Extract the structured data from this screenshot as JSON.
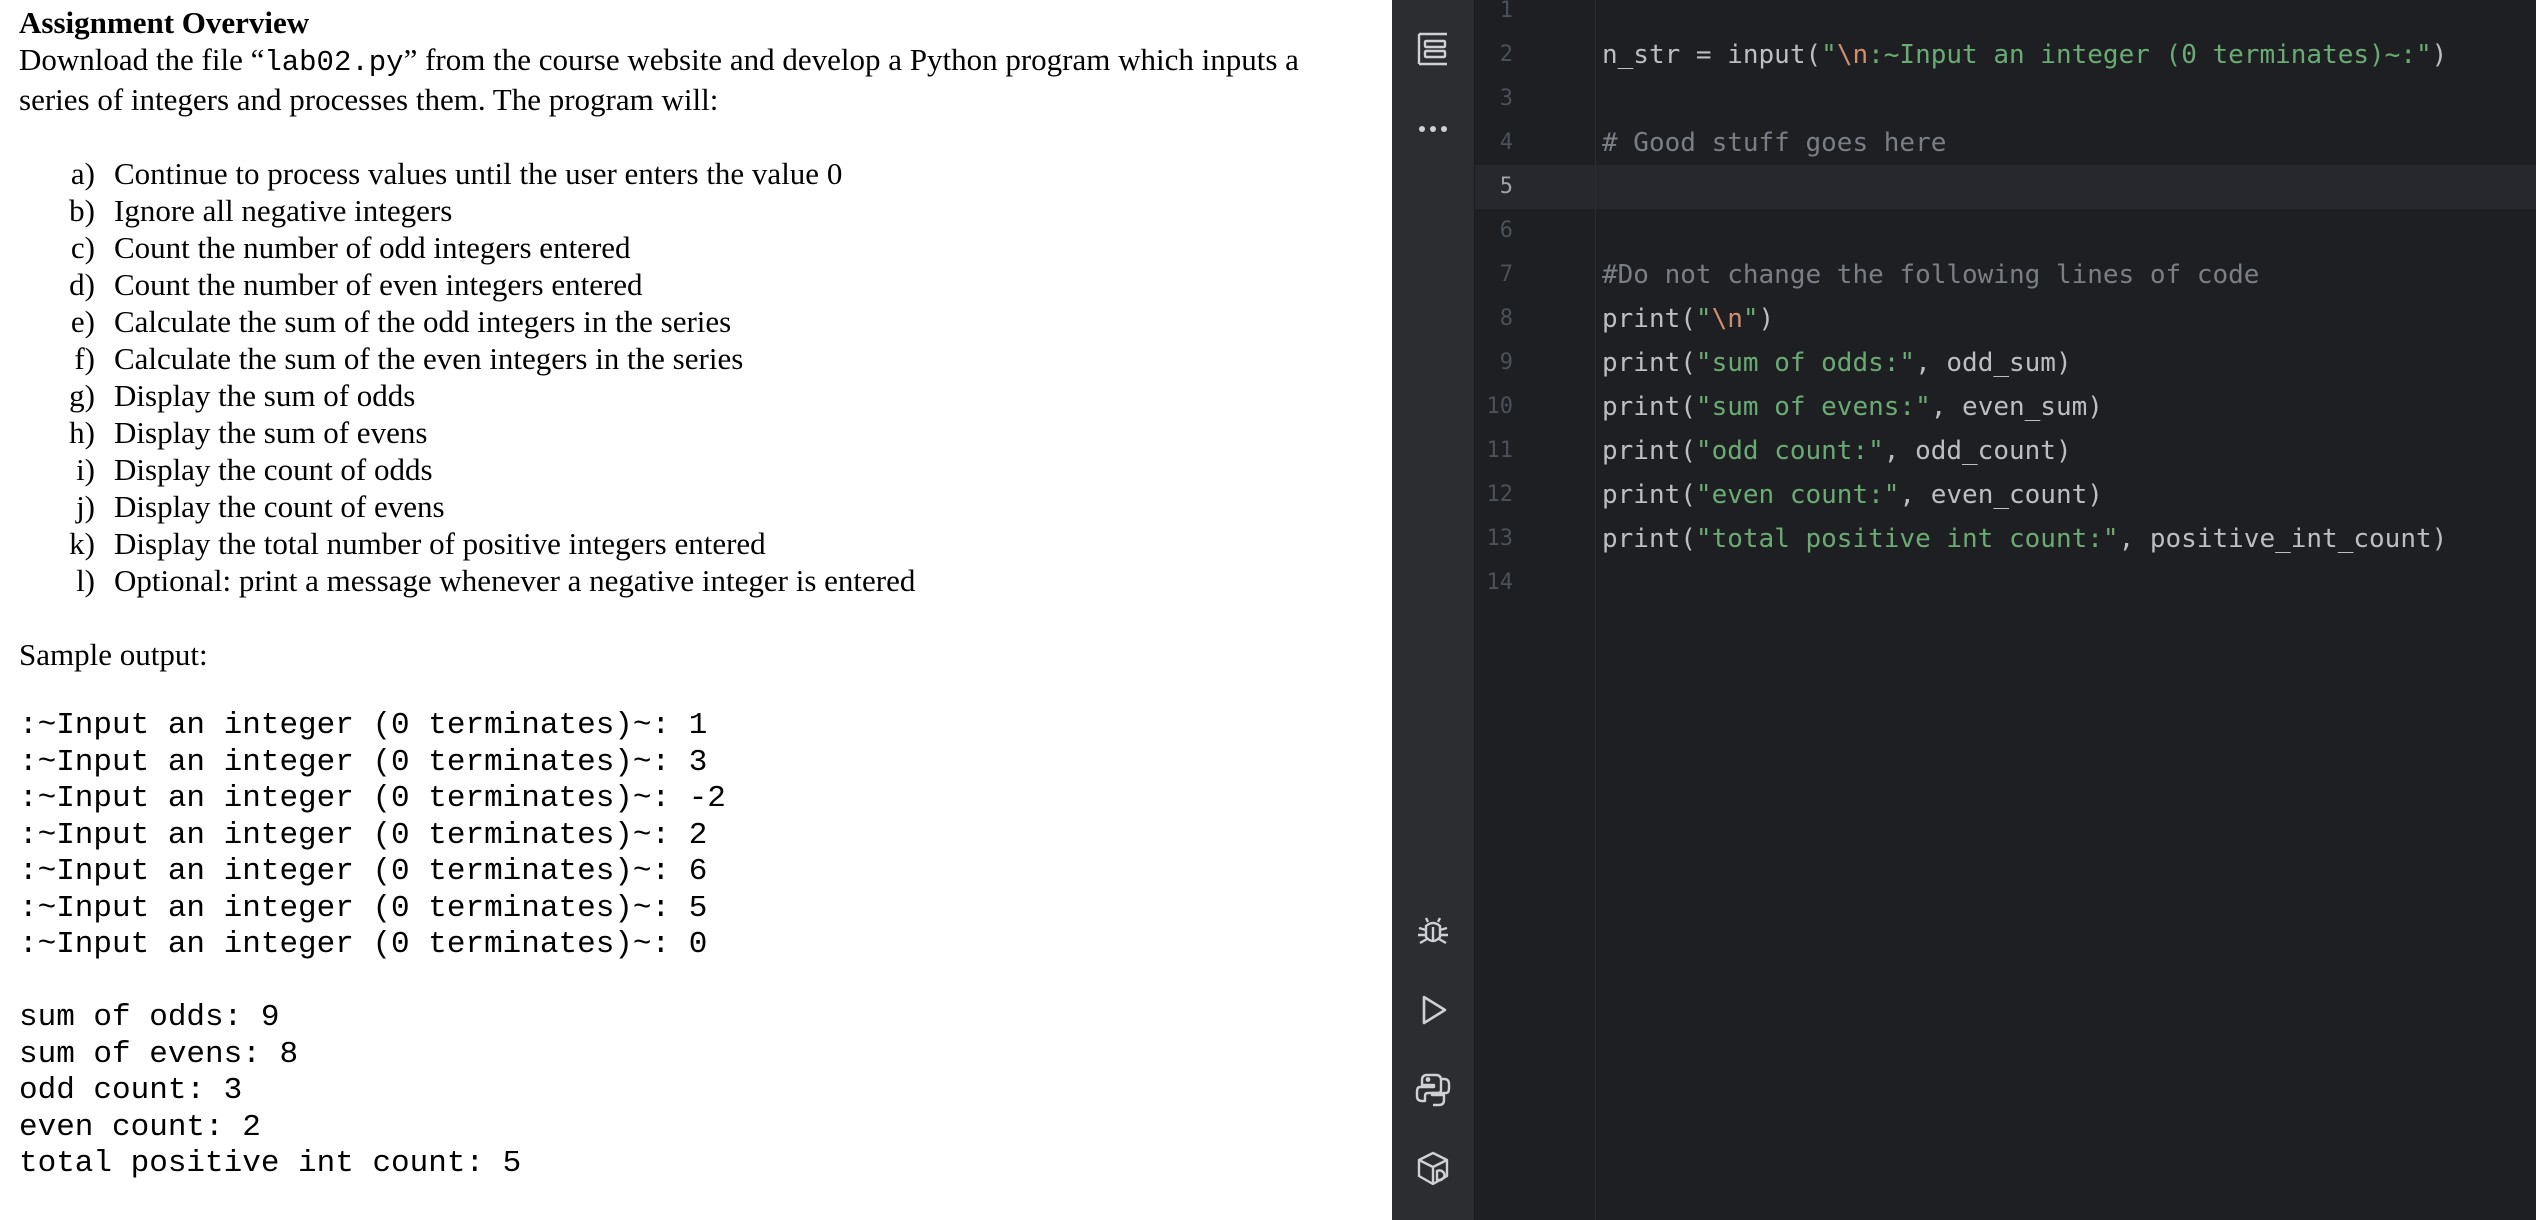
{
  "document": {
    "title": "Assignment Overview",
    "intro_before": "Download the file “",
    "intro_filename": "lab02.py",
    "intro_after": "” from the course website and develop a Python program which inputs a series of integers and processes them.  The program will:",
    "requirements": [
      {
        "letter": "a)",
        "text": "Continue to process values until the user enters the value 0"
      },
      {
        "letter": "b)",
        "text": "Ignore all negative integers"
      },
      {
        "letter": "c)",
        "text": "Count the number of odd integers entered"
      },
      {
        "letter": "d)",
        "text": "Count the number of even integers entered"
      },
      {
        "letter": "e)",
        "text": "Calculate the sum of the odd integers in the series"
      },
      {
        "letter": "f)",
        "text": "Calculate the sum of the even integers in the series"
      },
      {
        "letter": "g)",
        "text": "Display the sum of odds"
      },
      {
        "letter": "h)",
        "text": "Display the sum of evens"
      },
      {
        "letter": "i)",
        "text": "Display the count of odds"
      },
      {
        "letter": "j)",
        "text": "Display the count of evens"
      },
      {
        "letter": "k)",
        "text": "Display the total number of positive integers entered"
      },
      {
        "letter": "l)",
        "text": "Optional: print a message whenever a negative integer is entered"
      }
    ],
    "sample_label": "Sample output:",
    "sample_inputs": [
      ":~Input an integer (0 terminates)~: 1",
      ":~Input an integer (0 terminates)~: 3",
      ":~Input an integer (0 terminates)~: -2",
      ":~Input an integer (0 terminates)~: 2",
      ":~Input an integer (0 terminates)~: 6",
      ":~Input an integer (0 terminates)~: 5",
      ":~Input an integer (0 terminates)~: 0"
    ],
    "sample_results": [
      "sum of odds: 9",
      "sum of evens: 8",
      "odd count: 3",
      "even count: 2",
      "total positive int count: 5"
    ]
  },
  "ide": {
    "toolbar": [
      {
        "name": "structure-icon"
      },
      {
        "name": "more-icon"
      }
    ],
    "bottom_tools": [
      {
        "name": "debug-icon"
      },
      {
        "name": "run-icon"
      },
      {
        "name": "python-console-icon"
      },
      {
        "name": "python-packages-icon"
      }
    ],
    "active_line": 5,
    "lines": [
      {
        "n": "1",
        "code": ""
      },
      {
        "n": "2",
        "code": "n_str = input(\"\\n:~Input an integer (0 terminates)~:\")"
      },
      {
        "n": "3",
        "code": ""
      },
      {
        "n": "4",
        "code": "# Good stuff goes here"
      },
      {
        "n": "5",
        "code": ""
      },
      {
        "n": "6",
        "code": ""
      },
      {
        "n": "7",
        "code": "#Do not change the following lines of code"
      },
      {
        "n": "8",
        "code": "print(\"\\n\")"
      },
      {
        "n": "9",
        "code": "print(\"sum of odds:\", odd_sum)"
      },
      {
        "n": "10",
        "code": "print(\"sum of evens:\", even_sum)"
      },
      {
        "n": "11",
        "code": "print(\"odd count:\", odd_count)"
      },
      {
        "n": "12",
        "code": "print(\"even count:\", even_count)"
      },
      {
        "n": "13",
        "code": "print(\"total positive int count:\", positive_int_count)"
      },
      {
        "n": "14",
        "code": ""
      }
    ],
    "colors": {
      "background": "#1e1f22",
      "toolstrip": "#2b2d30",
      "text": "#bcbec4",
      "string": "#6aab73",
      "escape": "#cf8e6d",
      "comment": "#7a7e85"
    }
  }
}
